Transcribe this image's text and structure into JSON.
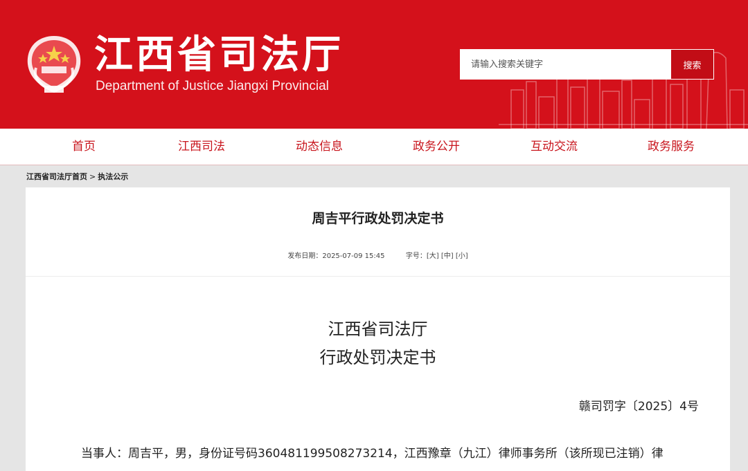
{
  "header": {
    "title": "江西省司法厅",
    "subtitle": "Department of Justice Jiangxi Provincial",
    "search": {
      "placeholder": "请输入搜索关键字",
      "button_label": "搜索"
    }
  },
  "nav": {
    "items": [
      {
        "label": "首页"
      },
      {
        "label": "江西司法"
      },
      {
        "label": "动态信息"
      },
      {
        "label": "政务公开"
      },
      {
        "label": "互动交流"
      },
      {
        "label": "政务服务"
      }
    ]
  },
  "breadcrumb": {
    "home": "江西省司法厅首页",
    "separator": ">",
    "current": "执法公示"
  },
  "article": {
    "title": "周吉平行政处罚决定书",
    "publish_label": "发布日期：",
    "publish_date": "2025-07-09 15:45",
    "font_size_label": "字号：",
    "font_large": "[大]",
    "font_medium": "[中]",
    "font_small": "[小]"
  },
  "document": {
    "org": "江西省司法厅",
    "type": "行政处罚决定书",
    "number": "赣司罚字〔2025〕4号",
    "paragraph": "当事人：周吉平，男，身份证号码360481199508273214，江西豫章（九江）律师事务所（该所现已注销）律"
  },
  "colors": {
    "brand_red": "#d4111b",
    "nav_text": "#c8141c"
  }
}
